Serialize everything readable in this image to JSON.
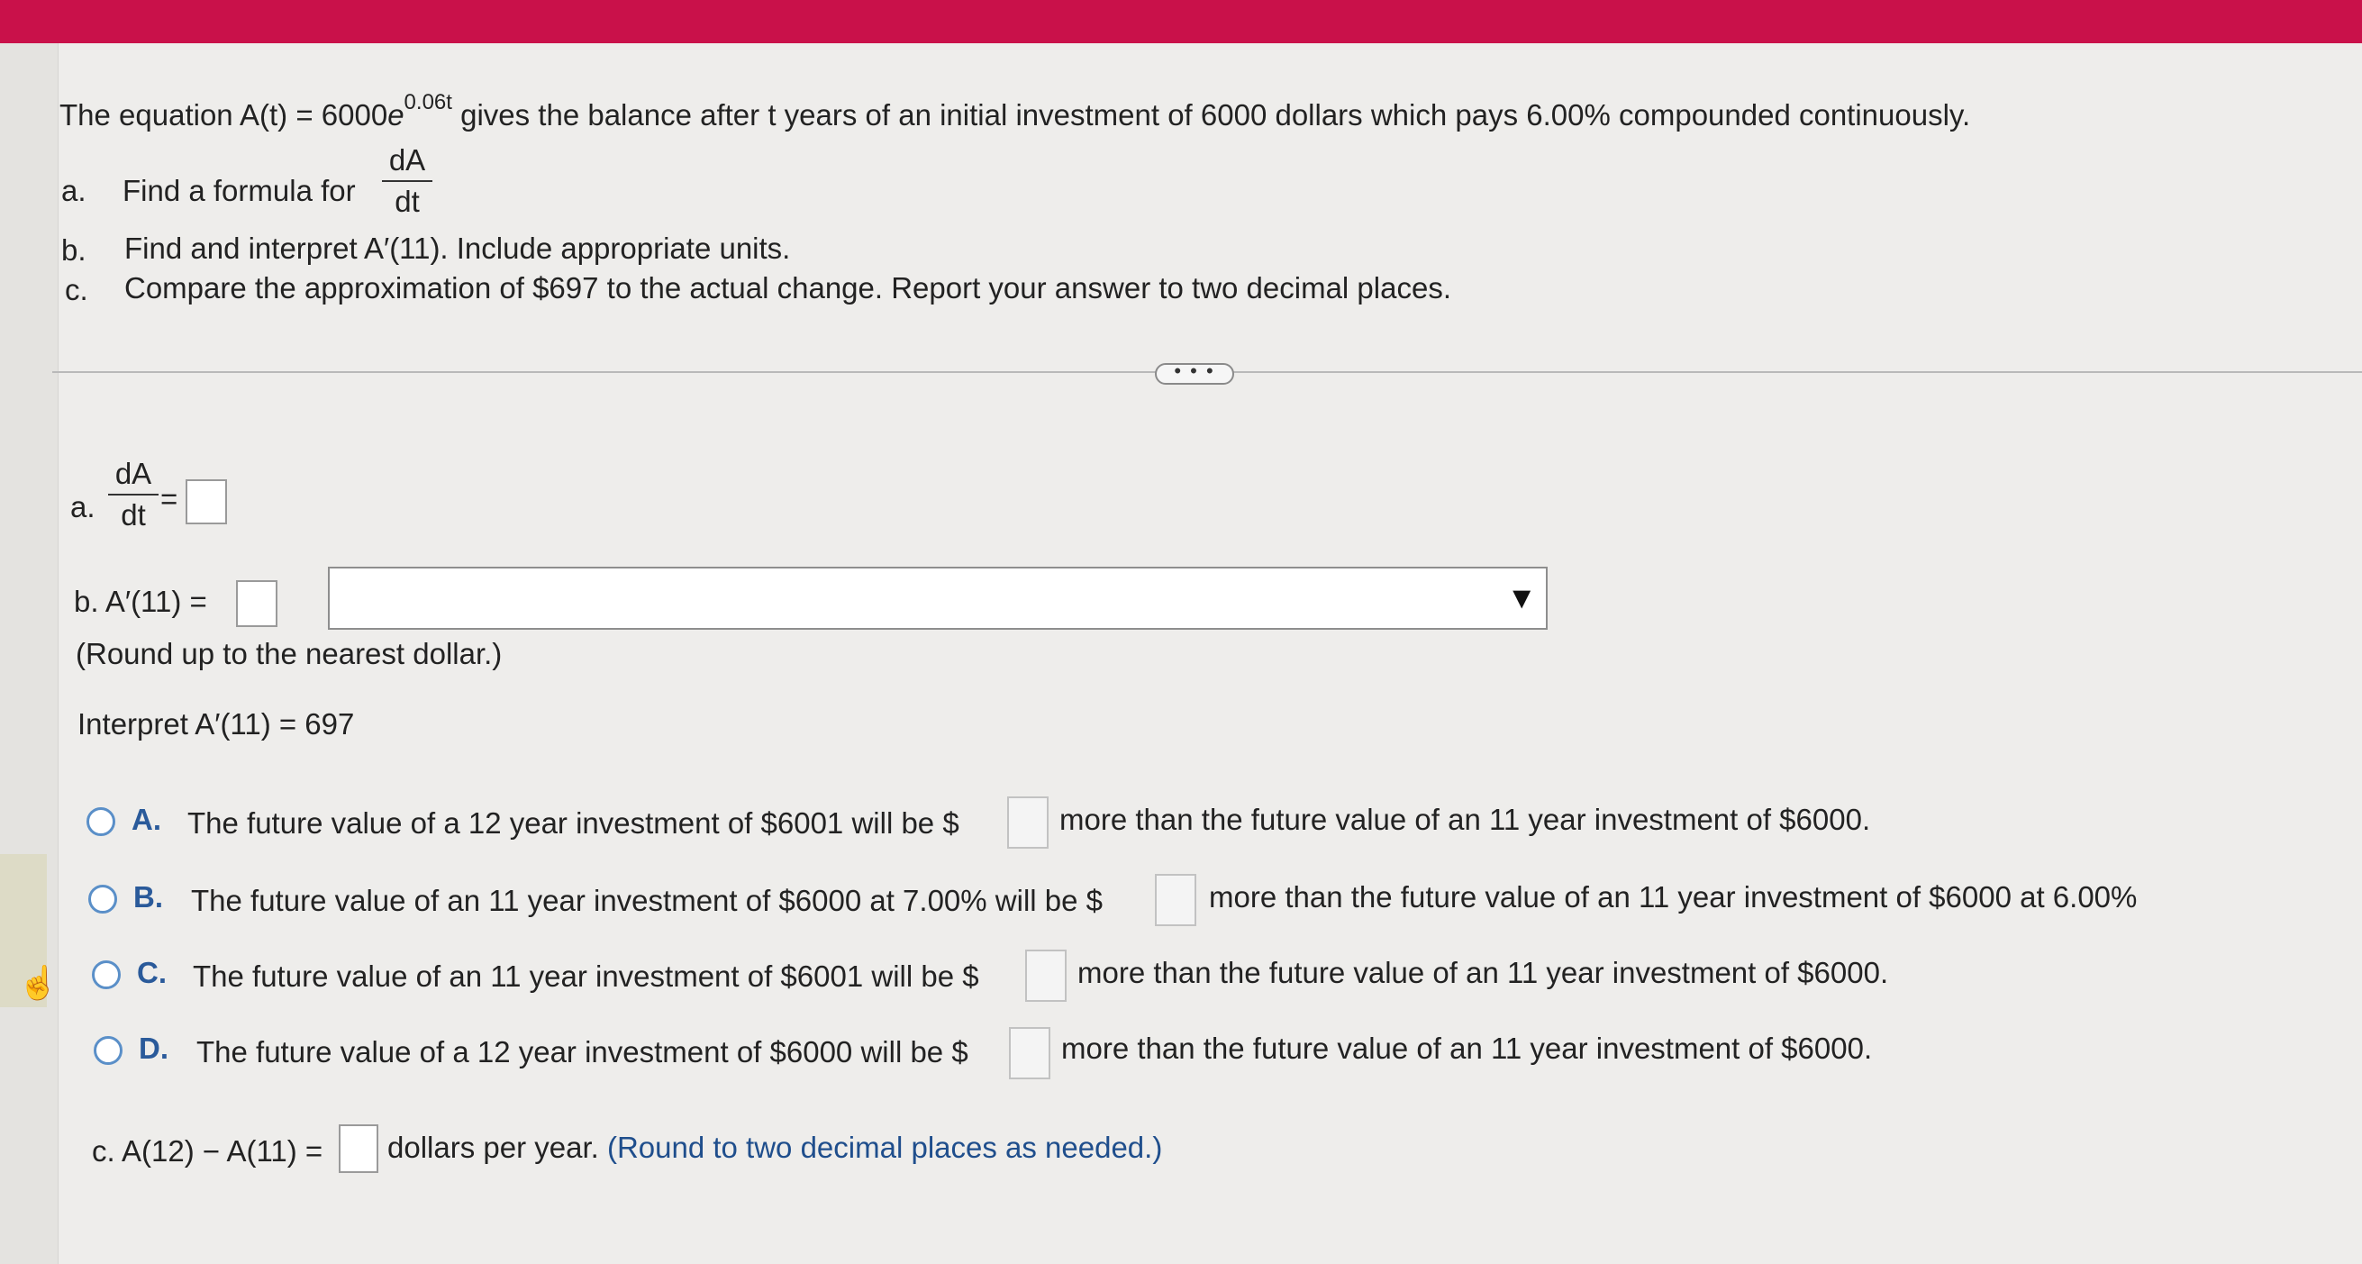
{
  "problem": {
    "intro_pre": "The equation A(t) = 6000",
    "intro_e": "e",
    "intro_exp": "0.06t",
    "intro_post": " gives the balance after t years of an initial investment of  6000 dollars which pays 6.00% compounded continuously.",
    "a_label": "a.",
    "a_text": "Find a formula for",
    "frac_num": "dA",
    "frac_den": "dt",
    "b_label": "b.",
    "b_text": "Find and interpret A′(11). Include appropriate units.",
    "c_label": "c.",
    "c_text": "Compare the approximation of $697 to the actual change. Report your answer to two decimal places."
  },
  "expand_button": "• • •",
  "answers": {
    "a_label": "a.",
    "a_num": "dA",
    "a_den": "dt",
    "a_equals": "=",
    "b_prefix": "b. A′(11) =",
    "b_round": "(Round up to the nearest dollar.)",
    "interpret": "Interpret A′(11) = 697",
    "options": [
      {
        "letter": "A.",
        "pre": "The future value of a 12 year investment of $6001 will be $",
        "post": "more than the future value of an 11 year investment of $6000."
      },
      {
        "letter": "B.",
        "pre": "The future value of an 11 year investment of $6000 at 7.00% will be $",
        "post": "more than the future value of an 11 year investment of $6000 at 6.00%"
      },
      {
        "letter": "C.",
        "pre": "The future value of an 11 year investment of $6001 will be $",
        "post": "more than the future value of an 11 year investment of $6000."
      },
      {
        "letter": "D.",
        "pre": "The future value of a 12 year investment of $6000 will be $",
        "post": "more than the future value of an 11 year investment of $6000."
      }
    ],
    "c_prefix": "c. A(12) − A(11) =",
    "c_units": "dollars per year.",
    "c_round": "(Round to two decimal places as needed.)"
  },
  "colors": {
    "topbar": "#c9114a",
    "radio_border": "#5a8fc8",
    "option_letter": "#2a5a9a",
    "hint_text": "#1f4e8c"
  },
  "icons": {
    "cursor": "hand-pointer-icon",
    "dropdown": "triangle-down-icon"
  }
}
